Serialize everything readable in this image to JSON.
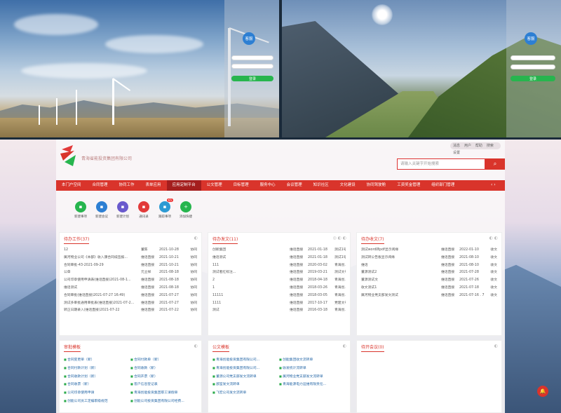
{
  "login": {
    "kefu": "客服",
    "login_button": "登录"
  },
  "header": {
    "company": "青海省能投资集团有限公司",
    "search_placeholder": "请输入关键字开始搜索",
    "top_icons": [
      "消息",
      "用户",
      "帮助",
      "搜索",
      "设置"
    ]
  },
  "nav": [
    {
      "label": "本门户空间",
      "active": false
    },
    {
      "label": "合同管理",
      "active": false
    },
    {
      "label": "协同工作",
      "active": false
    },
    {
      "label": "表单应用",
      "active": false
    },
    {
      "label": "应用定制平台",
      "active": true
    },
    {
      "label": "公文管理",
      "active": false
    },
    {
      "label": "目标管理",
      "active": false
    },
    {
      "label": "服务中心",
      "active": false
    },
    {
      "label": "会议管理",
      "active": false
    },
    {
      "label": "知识社区",
      "active": false
    },
    {
      "label": "文化建设",
      "active": false
    },
    {
      "label": "协同驾驶舱",
      "active": false
    },
    {
      "label": "工资奖金管理",
      "active": false
    },
    {
      "label": "组织部门管理",
      "active": false
    }
  ],
  "quick": [
    {
      "label": "新建事项",
      "icon": "doc-icon",
      "color": "#27b54e"
    },
    {
      "label": "新建会议",
      "icon": "meeting-icon",
      "color": "#2d7fd3"
    },
    {
      "label": "新建计划",
      "icon": "plan-icon",
      "color": "#6a5acd"
    },
    {
      "label": "通讯录",
      "icon": "contacts-icon",
      "color": "#e23a3a"
    },
    {
      "label": "跟踪事项",
      "icon": "track-icon",
      "color": "#2d9ad3",
      "badge": "65"
    },
    {
      "label": "添加快捷",
      "icon": "plus-icon",
      "color": "#27b54e"
    }
  ],
  "cards": {
    "todo": {
      "title": "待办工作(37)",
      "rows": [
        [
          "12",
          "董陈",
          "2021-10-28",
          "协同"
        ],
        [
          "属河物业公司《本部》收入康合同续签报...",
          "维话直接",
          "2021-10-21",
          "协同"
        ],
        [
          "合同审批-43-2021-09-29",
          "维话直接",
          "2021-10-21",
          "协同"
        ],
        [
          "公章",
          "元立样",
          "2021-08-18",
          "协同"
        ],
        [
          "公司印章使用申请表(维话直接)2021-08-1...",
          "维话直接",
          "2021-08-18",
          "协同"
        ],
        [
          "维话测试",
          "维话直接",
          "2021-08-18",
          "协同"
        ],
        [
          "合同审批(维话直接)2021-07-27 16:49)",
          "维话直接",
          "2021-07-27",
          "协同"
        ],
        [
          "测试多审批通用审批表(维话直接)2021-07-2...",
          "维话直接",
          "2021-07-27",
          "协同"
        ],
        [
          "转正日期录入(维话直接)2021-07-22",
          "维话直接",
          "2021-07-22",
          "协同"
        ]
      ]
    },
    "sent": {
      "title": "待办发文(11)",
      "rows": [
        [
          "创新集团",
          "维话直接",
          "2021-01-18",
          "测试1号"
        ],
        [
          "维话测试",
          "维话直接",
          "2021-01-18",
          "测试1号"
        ],
        [
          "111",
          "维话直接",
          "2020-03-02",
          "青海创..."
        ],
        [
          "测试者红标注...",
          "维话直接",
          "2019-03-21",
          "测试文号"
        ],
        [
          "2",
          "维话直接",
          "2018-04-18",
          "青海创..."
        ],
        [
          "1",
          "维话直接",
          "2018-03-26",
          "青海创..."
        ],
        [
          "11111",
          "维话直接",
          "2018-03-05",
          "青海创..."
        ],
        [
          "1111",
          "维话直接",
          "2017-10-17",
          "党建文号(2017)0038号"
        ],
        [
          "测试",
          "维话直接",
          "2016-03-18",
          "青海创..."
        ]
      ]
    },
    "received": {
      "title": "待办收文(7)",
      "rows": [
        [
          "测试word转pdf显示阅缘",
          "维话直接",
          "2022-01-10",
          "收文"
        ],
        [
          "测试转公告板显示阅缘",
          "维话直接",
          "2021-08-10",
          "收文"
        ],
        [
          "维话",
          "维话直接",
          "2021-08-10",
          "收文"
        ],
        [
          "董源测试2",
          "维话直接",
          "2021-07-28",
          "收文"
        ],
        [
          "董源测试文",
          "维话直接",
          "2021-07-26",
          "收文"
        ],
        [
          "收文测试1",
          "维话直接",
          "2021-07-18",
          "收文"
        ],
        [
          "属河物业党支部发文测试",
          "维话直接",
          "2021-07-16 . 7",
          "收文"
        ]
      ]
    },
    "review": {
      "title": "审批模板",
      "items": [
        "合同变更单（新）",
        "合同付款单（新）",
        "合同付款计划（新）",
        "合同收款（新）",
        "合同收款计划（新）",
        "合同开票（新）",
        "合同收票（新）",
        "客户信息登记表",
        "公司印章使用申请",
        "青海创能投资集团职工请假单",
        "创能公司员工定编职级规范",
        "创能公司投资集团有限公司经费..."
      ]
    },
    "docs": {
      "title": "公文模板",
      "items": [
        "青海创能投资集团有限公司...",
        "创能集团收文流转单",
        "青海创能投资集团有限公司...",
        "收发统计流转单",
        "董源公司党支部发文流转单",
        "属河物业党支部发文流转单",
        "部室发文流转单",
        "青海能源电力运维有限责任...",
        "飞宏公司发文流转单"
      ]
    },
    "meetings": {
      "title": "待开会议(0)"
    }
  },
  "colors": {
    "brand": "#d9342b",
    "green": "#27b54e"
  }
}
